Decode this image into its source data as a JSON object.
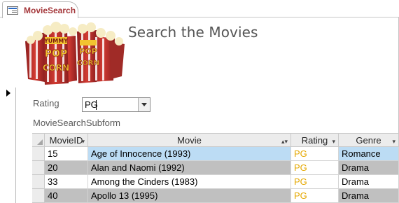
{
  "tab": {
    "label": "MovieSearch",
    "icon": "form-icon"
  },
  "form": {
    "title": "Search the Movies",
    "logo_text": [
      "YUMMY",
      "POP",
      "CORN"
    ],
    "logo_icon": "popcorn-logo"
  },
  "filter": {
    "rating_label": "Rating",
    "rating_value": "PG"
  },
  "subform": {
    "label": "MovieSearchSubform",
    "columns": [
      "MovieID",
      "Movie",
      "Rating",
      "Genre"
    ],
    "rows": [
      {
        "id": "15",
        "movie": "Age of Innocence (1993)",
        "rating": "PG",
        "genre": "Romance"
      },
      {
        "id": "20",
        "movie": "Alan and Naomi (1992)",
        "rating": "PG",
        "genre": "Drama"
      },
      {
        "id": "33",
        "movie": "Among the Cinders (1983)",
        "rating": "PG",
        "genre": "Drama"
      },
      {
        "id": "40",
        "movie": "Apollo 13 (1995)",
        "rating": "PG",
        "genre": "Drama"
      }
    ]
  },
  "colors": {
    "tab_text": "#a4373a",
    "rating_text": "#e5a800",
    "selected_row": "#bcdcf4",
    "alt_row": "#c0c0c0"
  }
}
